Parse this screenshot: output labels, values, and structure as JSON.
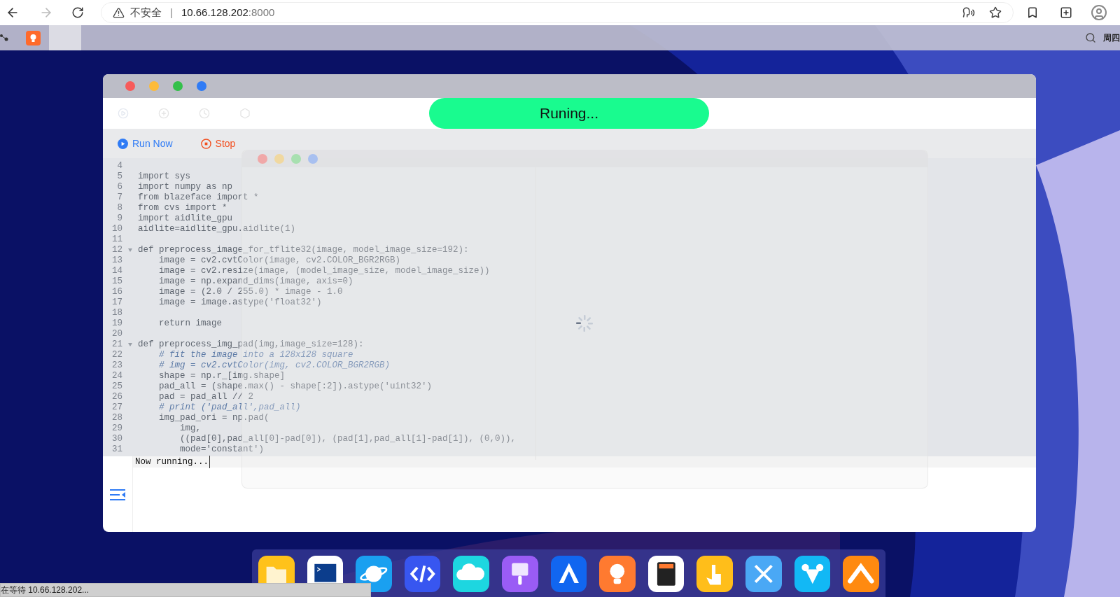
{
  "browser": {
    "security_label": "不安全",
    "separator": "|",
    "url_host": "10.66.128.202",
    "url_port": ":8000"
  },
  "desktop_bar": {
    "clock": "周四"
  },
  "app_window": {
    "status_pill": "Runing...",
    "actions": [
      {
        "label": "Run Now",
        "kind": "run"
      },
      {
        "label": "Stop",
        "kind": "stop"
      }
    ],
    "code_lines": [
      {
        "number": "4",
        "kind": "blank",
        "foldable": false
      },
      {
        "number": "5",
        "kind": "code",
        "text": "import sys",
        "foldable": false
      },
      {
        "number": "6",
        "kind": "code",
        "text": "import numpy as np",
        "foldable": false
      },
      {
        "number": "7",
        "kind": "code",
        "text": "from blazeface import *",
        "foldable": false
      },
      {
        "number": "8",
        "kind": "code",
        "text": "from cvs import *",
        "foldable": false
      },
      {
        "number": "9",
        "kind": "code",
        "text": "import aidlite_gpu",
        "foldable": false
      },
      {
        "number": "10",
        "kind": "code",
        "text": "aidlite=aidlite_gpu.aidlite(1)",
        "foldable": false
      },
      {
        "number": "11",
        "kind": "blank",
        "foldable": false
      },
      {
        "number": "12",
        "kind": "code",
        "text": "def preprocess_image_for_tflite32(image, model_image_size=192):",
        "foldable": true
      },
      {
        "number": "13",
        "kind": "code",
        "text": "    image = cv2.cvtColor(image, cv2.COLOR_BGR2RGB)",
        "foldable": false
      },
      {
        "number": "14",
        "kind": "code",
        "text": "    image = cv2.resize(image, (model_image_size, model_image_size))",
        "foldable": false
      },
      {
        "number": "15",
        "kind": "code",
        "text": "    image = np.expand_dims(image, axis=0)",
        "foldable": false
      },
      {
        "number": "16",
        "kind": "code",
        "text": "    image = (2.0 / 255.0) * image - 1.0",
        "foldable": false
      },
      {
        "number": "17",
        "kind": "code",
        "text": "    image = image.astype('float32')",
        "foldable": false
      },
      {
        "number": "18",
        "kind": "blank",
        "foldable": false
      },
      {
        "number": "19",
        "kind": "code",
        "text": "    return image",
        "foldable": false
      },
      {
        "number": "20",
        "kind": "blank",
        "foldable": false
      },
      {
        "number": "21",
        "kind": "code",
        "text": "def preprocess_img_pad(img,image_size=128):",
        "foldable": true
      },
      {
        "number": "22",
        "kind": "comment",
        "text": "    # fit the image into a 128x128 square",
        "foldable": false
      },
      {
        "number": "23",
        "kind": "comment",
        "text": "    # img = cv2.cvtColor(img, cv2.COLOR_BGR2RGB)",
        "foldable": false
      },
      {
        "number": "24",
        "kind": "code",
        "text": "    shape = np.r_[img.shape]",
        "foldable": false
      },
      {
        "number": "25",
        "kind": "code",
        "text": "    pad_all = (shape.max() - shape[:2]).astype('uint32')",
        "foldable": false
      },
      {
        "number": "26",
        "kind": "code",
        "text": "    pad = pad_all // 2",
        "foldable": false
      },
      {
        "number": "27",
        "kind": "comment",
        "text": "    # print ('pad_all',pad_all)",
        "foldable": false
      },
      {
        "number": "28",
        "kind": "code",
        "text": "    img_pad_ori = np.pad(",
        "foldable": false
      },
      {
        "number": "29",
        "kind": "code",
        "text": "        img,",
        "foldable": false
      },
      {
        "number": "30",
        "kind": "code",
        "text": "        ((pad[0],pad_all[0]-pad[0]), (pad[1],pad_all[1]-pad[1]), (0,0)),",
        "foldable": false
      },
      {
        "number": "31",
        "kind": "code",
        "text": "        mode='constant')",
        "foldable": false
      }
    ],
    "terminal_output": "Now running..."
  },
  "status_bubble": "在等待 10.66.128.202..."
}
